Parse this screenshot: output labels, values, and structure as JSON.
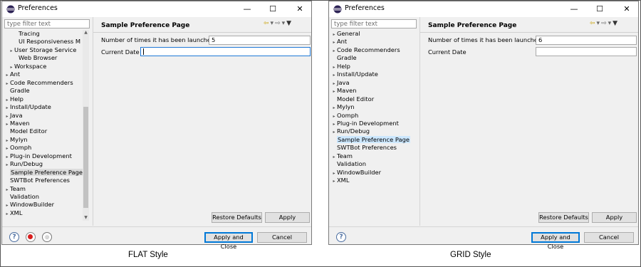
{
  "windows": [
    {
      "id": "flat",
      "title": "Preferences",
      "filter_placeholder": "type filter text",
      "tree_items": [
        {
          "label": "Tracing",
          "indent": 2,
          "arrow": ""
        },
        {
          "label": "UI Responsiveness M",
          "indent": 2,
          "arrow": ""
        },
        {
          "label": "User Storage Service",
          "indent": 1,
          "arrow": "▸"
        },
        {
          "label": "Web Browser",
          "indent": 2,
          "arrow": ""
        },
        {
          "label": "Workspace",
          "indent": 1,
          "arrow": "▸"
        },
        {
          "label": "Ant",
          "indent": 0,
          "arrow": "▸"
        },
        {
          "label": "Code Recommenders",
          "indent": 0,
          "arrow": "▸"
        },
        {
          "label": "Gradle",
          "indent": 0,
          "arrow": ""
        },
        {
          "label": "Help",
          "indent": 0,
          "arrow": "▸"
        },
        {
          "label": "Install/Update",
          "indent": 0,
          "arrow": "▸"
        },
        {
          "label": "Java",
          "indent": 0,
          "arrow": "▸"
        },
        {
          "label": "Maven",
          "indent": 0,
          "arrow": "▸"
        },
        {
          "label": "Model Editor",
          "indent": 0,
          "arrow": ""
        },
        {
          "label": "Mylyn",
          "indent": 0,
          "arrow": "▸"
        },
        {
          "label": "Oomph",
          "indent": 0,
          "arrow": "▸"
        },
        {
          "label": "Plug-in Development",
          "indent": 0,
          "arrow": "▸"
        },
        {
          "label": "Run/Debug",
          "indent": 0,
          "arrow": "▸"
        },
        {
          "label": "Sample Preference Page",
          "indent": 0,
          "arrow": "",
          "selected": true
        },
        {
          "label": "SWTBot Preferences",
          "indent": 0,
          "arrow": ""
        },
        {
          "label": "Team",
          "indent": 0,
          "arrow": "▸"
        },
        {
          "label": "Validation",
          "indent": 0,
          "arrow": ""
        },
        {
          "label": "WindowBuilder",
          "indent": 0,
          "arrow": "▸"
        },
        {
          "label": "XML",
          "indent": 0,
          "arrow": "▸"
        }
      ],
      "page_title": "Sample Preference Page",
      "launch_label": "Number of times it has been launched",
      "launch_value": "5",
      "date_label": "Current Date",
      "date_value": "",
      "restore_label": "Restore Defaults",
      "apply_label": "Apply",
      "apply_close_label": "Apply and Close",
      "cancel_label": "Cancel",
      "caption": "FLAT Style"
    },
    {
      "id": "grid",
      "title": "Preferences",
      "filter_placeholder": "type filter text",
      "tree_items": [
        {
          "label": "General",
          "indent": 0,
          "arrow": "▸"
        },
        {
          "label": "Ant",
          "indent": 0,
          "arrow": "▸"
        },
        {
          "label": "Code Recommenders",
          "indent": 0,
          "arrow": "▸"
        },
        {
          "label": "Gradle",
          "indent": 0,
          "arrow": ""
        },
        {
          "label": "Help",
          "indent": 0,
          "arrow": "▸"
        },
        {
          "label": "Install/Update",
          "indent": 0,
          "arrow": "▸"
        },
        {
          "label": "Java",
          "indent": 0,
          "arrow": "▸"
        },
        {
          "label": "Maven",
          "indent": 0,
          "arrow": "▸"
        },
        {
          "label": "Model Editor",
          "indent": 0,
          "arrow": ""
        },
        {
          "label": "Mylyn",
          "indent": 0,
          "arrow": "▸"
        },
        {
          "label": "Oomph",
          "indent": 0,
          "arrow": "▸"
        },
        {
          "label": "Plug-in Development",
          "indent": 0,
          "arrow": "▸"
        },
        {
          "label": "Run/Debug",
          "indent": 0,
          "arrow": "▸"
        },
        {
          "label": "Sample Preference Page",
          "indent": 0,
          "arrow": "",
          "selected": true
        },
        {
          "label": "SWTBot Preferences",
          "indent": 0,
          "arrow": ""
        },
        {
          "label": "Team",
          "indent": 0,
          "arrow": "▸"
        },
        {
          "label": "Validation",
          "indent": 0,
          "arrow": ""
        },
        {
          "label": "WindowBuilder",
          "indent": 0,
          "arrow": "▸"
        },
        {
          "label": "XML",
          "indent": 0,
          "arrow": "▸"
        }
      ],
      "page_title": "Sample Preference Page",
      "launch_label": "Number of times it has been launched",
      "launch_value": "6",
      "date_label": "Current Date",
      "date_value": "",
      "restore_label": "Restore Defaults",
      "apply_label": "Apply",
      "apply_close_label": "Apply and Close",
      "cancel_label": "Cancel",
      "caption": "GRID Style"
    }
  ],
  "icons": {
    "back": "⇦",
    "forward": "⇨",
    "dropdown": "▾",
    "view_menu": "▼",
    "minimize": "—",
    "maximize": "☐",
    "close": "✕",
    "help": "?"
  },
  "colors": {
    "selection_flat": "#dcdcdc",
    "selection_grid": "#cde8ff",
    "default_button_border": "#0078d7"
  }
}
